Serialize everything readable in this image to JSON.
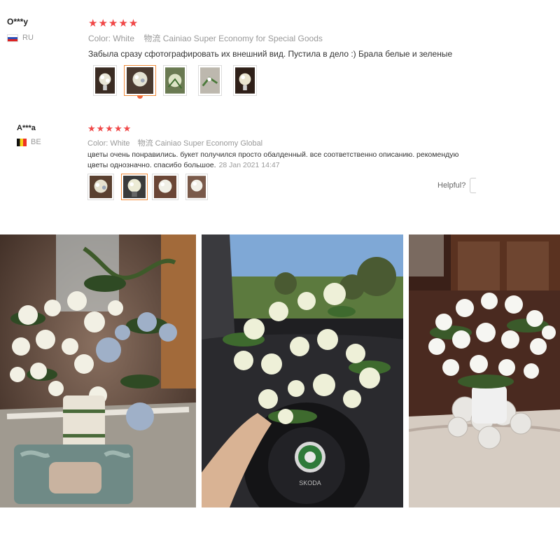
{
  "reviews": [
    {
      "user": "O***y",
      "country": "RU",
      "stars": "★★★★★",
      "color_label": "Color:",
      "color_value": "White",
      "shipping_label": "物流",
      "shipping_value": "Cainiao Super Economy for Special Goods",
      "text": "Забыла сразу сфотографировать их внешний вид. Пустила в дело :) Брала белые и зеленые"
    },
    {
      "user": "A***a",
      "country": "BE",
      "stars": "★★★★★",
      "color_label": "Color:",
      "color_value": "White",
      "shipping_label": "物流",
      "shipping_value": "Cainiao Super Economy Global",
      "text_line1": "цветы очень понравились. букет получился просто обалденный. все соответственно описанию. рекомендую",
      "text_line2": "цветы однозначно. спасибо большое.",
      "date": "28 Jan 2021 14:47",
      "helpful_label": "Helpful?"
    }
  ],
  "photos": {
    "car_badge": "SKODA"
  },
  "colors": {
    "star": "#f04848",
    "selected_border": "#f08c3c"
  }
}
